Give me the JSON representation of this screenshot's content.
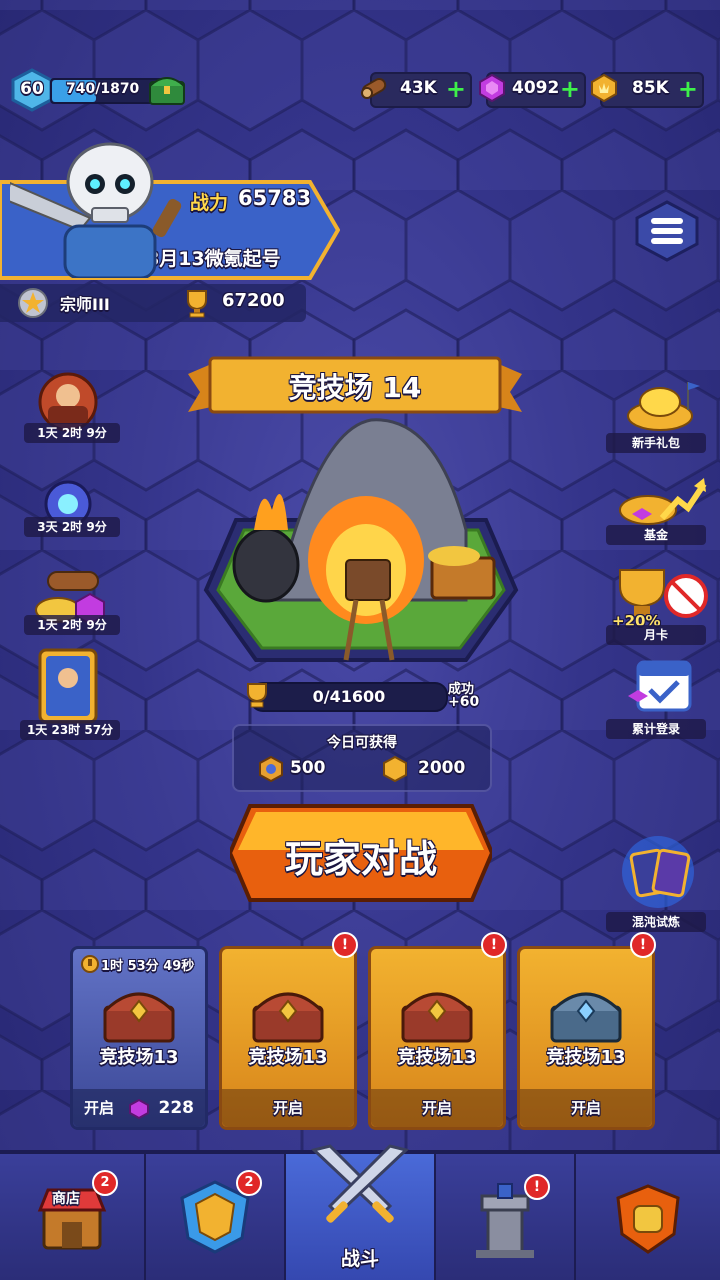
{
  "player": {
    "level": "60",
    "xp": "740/1870",
    "xp_fraction": 0.3957,
    "power_label": "战力",
    "power_value": "65783",
    "name": "8月13微氪起号",
    "rank_name": "宗师III",
    "trophies": "67200"
  },
  "resources": {
    "wood": "43K",
    "gems": "4092",
    "gold": "85K",
    "plus": "+"
  },
  "arena": {
    "title": "竞技场 14",
    "progress": "0/41600",
    "progress_fraction": 0,
    "win_label": "成功",
    "win_bonus": "+60",
    "today_label": "今日可获得",
    "today_medals": "500",
    "today_gold": "2000",
    "battle_button": "玩家对战"
  },
  "left_events": [
    {
      "icon": "warrior-event-icon",
      "timer": "1天 2时 9分"
    },
    {
      "icon": "magic-orb-event-icon",
      "timer": "3天 2时 9分"
    },
    {
      "icon": "resource-pack-icon",
      "timer": "1天 2时 9分"
    },
    {
      "icon": "hero-card-event-icon",
      "timer": "1天 23时 57分"
    }
  ],
  "right_events": [
    {
      "icon": "gold-pile-icon",
      "label": "新手礼包"
    },
    {
      "icon": "fund-growth-icon",
      "label": "基金"
    },
    {
      "icon": "trophy-card-icon",
      "label": "月卡",
      "bonus": "+20%"
    },
    {
      "icon": "calendar-icon",
      "label": "累计登录"
    },
    {
      "icon": "chaos-cards-icon",
      "label": "混沌试炼"
    }
  ],
  "chests": [
    {
      "timer": "1时 53分 49秒",
      "label": "竞技场13",
      "open": "开启",
      "cost": "228",
      "style": "blue",
      "alert": ""
    },
    {
      "label": "竞技场13",
      "open": "开启",
      "style": "gold",
      "alert": "!"
    },
    {
      "label": "竞技场13",
      "open": "开启",
      "style": "gold",
      "alert": "!"
    },
    {
      "label": "竞技场13",
      "open": "开启",
      "style": "gold",
      "alert": "!"
    }
  ],
  "nav": {
    "shop_label": "商店",
    "shop_badge": "2",
    "heroes_badge": "2",
    "battle_label": "战斗",
    "tower_alert": "!"
  },
  "colors": {
    "accent_gold": "#f2b230",
    "bg_purple": "#34348a",
    "plus_green": "#3ef04a",
    "alert_red": "#e02828"
  }
}
